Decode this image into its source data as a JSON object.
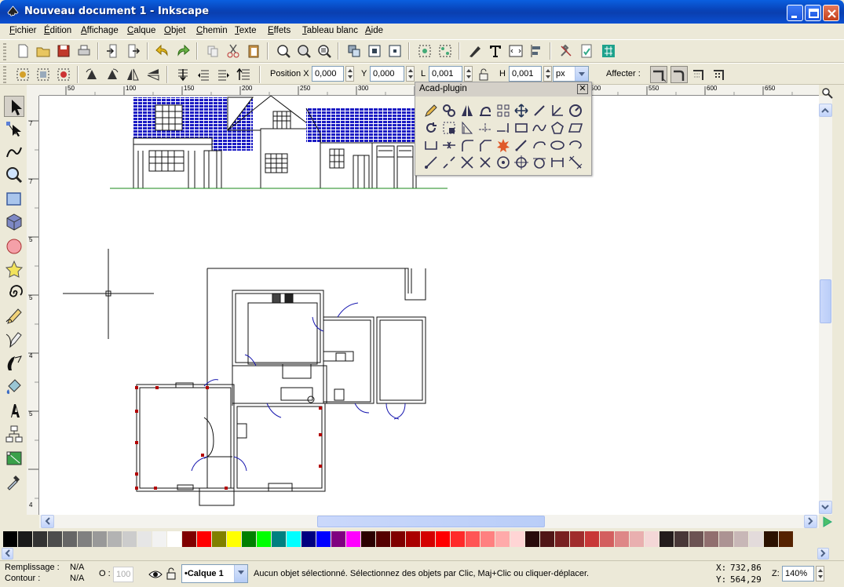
{
  "window": {
    "title": "Nouveau document 1 - Inkscape"
  },
  "menu": [
    "Fichier",
    "Édition",
    "Affichage",
    "Calque",
    "Objet",
    "Chemin",
    "Texte",
    "Effets",
    "Tableau blanc",
    "Aide"
  ],
  "controls": {
    "pos_x_label": "Position X",
    "pos_x_value": "0,000",
    "y_label": "Y",
    "y_value": "0,000",
    "l_label": "L",
    "l_value": "0,001",
    "h_label": "H",
    "h_value": "0,001",
    "unit": "px",
    "affect_label": "Affecter :"
  },
  "rulers": {
    "h_ticks": [
      "50",
      "100",
      "150",
      "200",
      "250",
      "300",
      "350",
      "400",
      "450",
      "500",
      "550",
      "600",
      "650",
      "700"
    ],
    "v_ticks": [
      "7",
      "0",
      "0",
      "7",
      "5",
      "0",
      "5",
      "5",
      "0",
      "5",
      "5",
      "0",
      "4",
      "5",
      "0",
      "5",
      "0",
      "0",
      "4"
    ]
  },
  "dialog": {
    "title": "Acad-plugin",
    "close": "✕"
  },
  "status": {
    "fill_label": "Remplissage :",
    "fill_value": "N/A",
    "stroke_label": "Contour :",
    "stroke_value": "N/A",
    "opacity_label": "O :",
    "opacity_value": "100",
    "layer": "•Calque 1",
    "message": "Aucun objet sélectionné. Sélectionnez des objets par Clic, Maj+Clic ou cliquer-déplacer.",
    "x_label": "X:",
    "x_value": "732,86",
    "y_label": "Y:",
    "y_value": "564,29",
    "zoom_label": "Z:",
    "zoom_value": "140%"
  },
  "palette_colors": [
    "#000000",
    "#1a1a1a",
    "#333333",
    "#4d4d4d",
    "#666666",
    "#808080",
    "#999999",
    "#b3b3b3",
    "#cccccc",
    "#e6e6e6",
    "#f2f2f2",
    "#ffffff",
    "#800000",
    "#ff0000",
    "#808000",
    "#ffff00",
    "#008000",
    "#00ff00",
    "#008080",
    "#00ffff",
    "#000080",
    "#0000ff",
    "#800080",
    "#ff00ff",
    "#2b0000",
    "#550000",
    "#800000",
    "#aa0000",
    "#d40000",
    "#ff0000",
    "#ff2a2a",
    "#ff5555",
    "#ff8080",
    "#ffaaaa",
    "#ffd5d5",
    "#280b0b",
    "#501616",
    "#782121",
    "#a02c2c",
    "#c83737",
    "#d35f5f",
    "#de8787",
    "#e9afaf",
    "#f4d7d7",
    "#241c1c",
    "#483737",
    "#6c5353",
    "#916f6f",
    "#ac9393",
    "#c8b7b7",
    "#e3dbdb",
    "#2b1100",
    "#552200"
  ]
}
